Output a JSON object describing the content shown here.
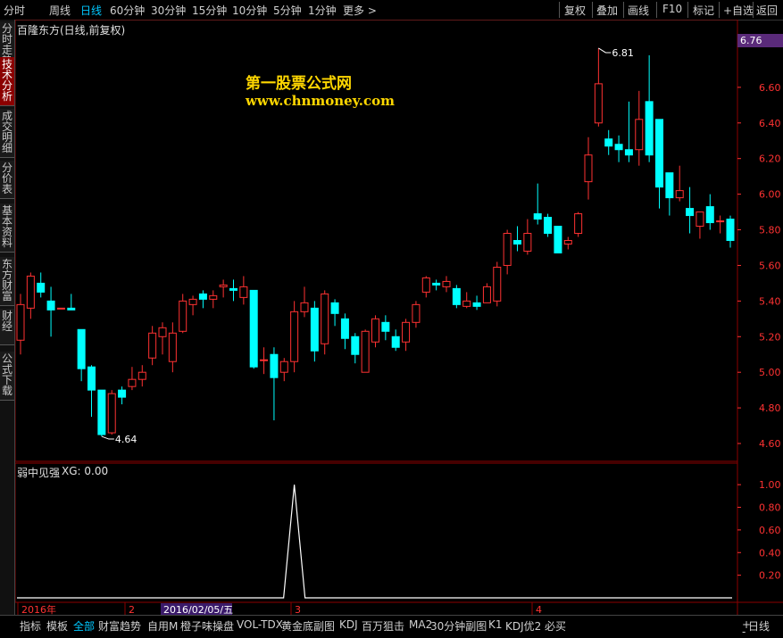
{
  "topbar": {
    "tabs": [
      "分时",
      "周线",
      "日线",
      "60分钟",
      "30分钟",
      "15分钟",
      "10分钟",
      "5分钟",
      "1分钟",
      "更多 >"
    ],
    "active_tab": "日线",
    "right_buttons": [
      "复权",
      "叠加",
      "画线",
      "F10",
      "标记",
      "+自选",
      "返回"
    ]
  },
  "left_tabs": [
    "分时走势",
    "技术分析",
    "成交明细",
    "分价表",
    "基本资料",
    "东方财富",
    "财经",
    "公式下载"
  ],
  "active_left_tab": "技术分析",
  "chart_title": "百隆东方(日线,前复权)",
  "watermark": {
    "line1": "第一股票公式网",
    "line2": "www.chnmoney.com"
  },
  "current_price": "6.76",
  "high_label": "6.81",
  "low_label": "4.64",
  "indicator": {
    "name": "弱中见强",
    "xg": "XG: 0.00"
  },
  "x_labels": {
    "year": "2016年",
    "m2": "2",
    "date_box": "2016/02/05/五",
    "m3": "3",
    "m4": "4"
  },
  "bottombar": {
    "items": [
      "指标",
      "模板",
      "全部",
      "财富趋势",
      "自用M",
      "橙子味操盘",
      "VOL-TDX",
      "黄金底副图",
      "KDJ",
      "百万狙击",
      "MA2",
      "30分钟副图",
      "K1",
      "KDJ优2",
      "必买"
    ],
    "active": "全部",
    "right_controls": [
      "+",
      "-",
      "日线"
    ]
  },
  "colors": {
    "up": "#ff3232",
    "down": "#00ffff",
    "grid": "#8b0000",
    "axis_text": "#ff3232"
  },
  "chart_data": [
    {
      "type": "candlestick",
      "title": "百隆东方(日线,前复权)",
      "ylim": [
        4.55,
        6.9
      ],
      "yticks": [
        4.6,
        4.8,
        5.0,
        5.2,
        5.4,
        5.6,
        5.8,
        6.0,
        6.2,
        6.4,
        6.6
      ],
      "candles": [
        {
          "o": 5.18,
          "c": 5.38,
          "h": 5.44,
          "l": 5.1
        },
        {
          "o": 5.36,
          "c": 5.54,
          "h": 5.56,
          "l": 5.3
        },
        {
          "o": 5.5,
          "c": 5.45,
          "h": 5.56,
          "l": 5.42
        },
        {
          "o": 5.4,
          "c": 5.35,
          "h": 5.48,
          "l": 5.2
        },
        {
          "o": 5.36,
          "c": 5.36,
          "h": 5.36,
          "l": 5.36
        },
        {
          "o": 5.36,
          "c": 5.35,
          "h": 5.44,
          "l": 5.36
        },
        {
          "o": 5.24,
          "c": 5.02,
          "h": 5.24,
          "l": 4.95
        },
        {
          "o": 5.03,
          "c": 4.9,
          "h": 5.04,
          "l": 4.75
        },
        {
          "o": 4.9,
          "c": 4.65,
          "h": 4.9,
          "l": 4.64
        },
        {
          "o": 4.66,
          "c": 4.88,
          "h": 4.9,
          "l": 4.65
        },
        {
          "o": 4.9,
          "c": 4.86,
          "h": 4.92,
          "l": 4.82
        },
        {
          "o": 4.92,
          "c": 4.96,
          "h": 5.03,
          "l": 4.9
        },
        {
          "o": 4.96,
          "c": 5.0,
          "h": 5.04,
          "l": 4.92
        },
        {
          "o": 5.08,
          "c": 5.22,
          "h": 5.26,
          "l": 5.04
        },
        {
          "o": 5.2,
          "c": 5.25,
          "h": 5.28,
          "l": 5.1
        },
        {
          "o": 5.06,
          "c": 5.22,
          "h": 5.28,
          "l": 5.0
        },
        {
          "o": 5.23,
          "c": 5.4,
          "h": 5.44,
          "l": 5.22
        },
        {
          "o": 5.38,
          "c": 5.41,
          "h": 5.43,
          "l": 5.32
        },
        {
          "o": 5.44,
          "c": 5.41,
          "h": 5.46,
          "l": 5.36
        },
        {
          "o": 5.41,
          "c": 5.43,
          "h": 5.46,
          "l": 5.36
        },
        {
          "o": 5.48,
          "c": 5.49,
          "h": 5.52,
          "l": 5.42
        },
        {
          "o": 5.47,
          "c": 5.46,
          "h": 5.52,
          "l": 5.4
        },
        {
          "o": 5.42,
          "c": 5.48,
          "h": 5.54,
          "l": 5.38
        },
        {
          "o": 5.46,
          "c": 5.03,
          "h": 5.46,
          "l": 5.02
        },
        {
          "o": 5.07,
          "c": 5.07,
          "h": 5.14,
          "l": 4.99
        },
        {
          "o": 5.1,
          "c": 4.97,
          "h": 5.14,
          "l": 4.73
        },
        {
          "o": 5.0,
          "c": 5.06,
          "h": 5.08,
          "l": 4.95
        },
        {
          "o": 5.06,
          "c": 5.34,
          "h": 5.4,
          "l": 5.0
        },
        {
          "o": 5.34,
          "c": 5.39,
          "h": 5.48,
          "l": 5.31
        },
        {
          "o": 5.36,
          "c": 5.12,
          "h": 5.4,
          "l": 5.06
        },
        {
          "o": 5.16,
          "c": 5.44,
          "h": 5.46,
          "l": 5.1
        },
        {
          "o": 5.39,
          "c": 5.33,
          "h": 5.41,
          "l": 5.26
        },
        {
          "o": 5.3,
          "c": 5.19,
          "h": 5.33,
          "l": 5.13
        },
        {
          "o": 5.2,
          "c": 5.1,
          "h": 5.22,
          "l": 5.05
        },
        {
          "o": 5.0,
          "c": 5.23,
          "h": 5.24,
          "l": 5.0
        },
        {
          "o": 5.17,
          "c": 5.3,
          "h": 5.32,
          "l": 5.14
        },
        {
          "o": 5.28,
          "c": 5.23,
          "h": 5.32,
          "l": 5.18
        },
        {
          "o": 5.2,
          "c": 5.14,
          "h": 5.24,
          "l": 5.12
        },
        {
          "o": 5.17,
          "c": 5.28,
          "h": 5.3,
          "l": 5.12
        },
        {
          "o": 5.28,
          "c": 5.38,
          "h": 5.4,
          "l": 5.25
        },
        {
          "o": 5.45,
          "c": 5.53,
          "h": 5.54,
          "l": 5.42
        },
        {
          "o": 5.5,
          "c": 5.49,
          "h": 5.52,
          "l": 5.46
        },
        {
          "o": 5.48,
          "c": 5.51,
          "h": 5.54,
          "l": 5.45
        },
        {
          "o": 5.47,
          "c": 5.38,
          "h": 5.49,
          "l": 5.36
        },
        {
          "o": 5.37,
          "c": 5.4,
          "h": 5.45,
          "l": 5.36
        },
        {
          "o": 5.39,
          "c": 5.37,
          "h": 5.43,
          "l": 5.35
        },
        {
          "o": 5.39,
          "c": 5.48,
          "h": 5.5,
          "l": 5.39
        },
        {
          "o": 5.4,
          "c": 5.59,
          "h": 5.62,
          "l": 5.37
        },
        {
          "o": 5.6,
          "c": 5.78,
          "h": 5.8,
          "l": 5.55
        },
        {
          "o": 5.74,
          "c": 5.72,
          "h": 5.82,
          "l": 5.68
        },
        {
          "o": 5.68,
          "c": 5.78,
          "h": 5.86,
          "l": 5.66
        },
        {
          "o": 5.89,
          "c": 5.86,
          "h": 6.06,
          "l": 5.83
        },
        {
          "o": 5.87,
          "c": 5.78,
          "h": 5.89,
          "l": 5.76
        },
        {
          "o": 5.82,
          "c": 5.67,
          "h": 5.82,
          "l": 5.67
        },
        {
          "o": 5.72,
          "c": 5.74,
          "h": 5.76,
          "l": 5.69
        },
        {
          "o": 5.78,
          "c": 5.89,
          "h": 5.9,
          "l": 5.76
        },
        {
          "o": 6.07,
          "c": 6.22,
          "h": 6.32,
          "l": 5.97
        },
        {
          "o": 6.4,
          "c": 6.62,
          "h": 6.82,
          "l": 6.38
        },
        {
          "o": 6.31,
          "c": 6.27,
          "h": 6.36,
          "l": 6.22
        },
        {
          "o": 6.28,
          "c": 6.25,
          "h": 6.33,
          "l": 6.18
        },
        {
          "o": 6.25,
          "c": 6.22,
          "h": 6.52,
          "l": 6.18
        },
        {
          "o": 6.25,
          "c": 6.42,
          "h": 6.58,
          "l": 6.16
        },
        {
          "o": 6.52,
          "c": 6.22,
          "h": 6.78,
          "l": 6.18
        },
        {
          "o": 6.42,
          "c": 6.04,
          "h": 6.42,
          "l": 5.92
        },
        {
          "o": 6.12,
          "c": 5.98,
          "h": 6.12,
          "l": 5.88
        },
        {
          "o": 5.98,
          "c": 6.02,
          "h": 6.16,
          "l": 5.96
        },
        {
          "o": 5.92,
          "c": 5.88,
          "h": 6.04,
          "l": 5.78
        },
        {
          "o": 5.82,
          "c": 5.9,
          "h": 5.9,
          "l": 5.75
        },
        {
          "o": 5.93,
          "c": 5.84,
          "h": 6.0,
          "l": 5.8
        },
        {
          "o": 5.85,
          "c": 5.85,
          "h": 5.88,
          "l": 5.78
        },
        {
          "o": 5.86,
          "c": 5.74,
          "h": 5.88,
          "l": 5.7
        }
      ]
    },
    {
      "type": "line",
      "title": "弱中见强",
      "ylim": [
        0,
        1.08
      ],
      "yticks": [
        0.2,
        0.4,
        0.6,
        0.8,
        1.0
      ],
      "peak_index": 27,
      "values_note_none": ""
    }
  ]
}
